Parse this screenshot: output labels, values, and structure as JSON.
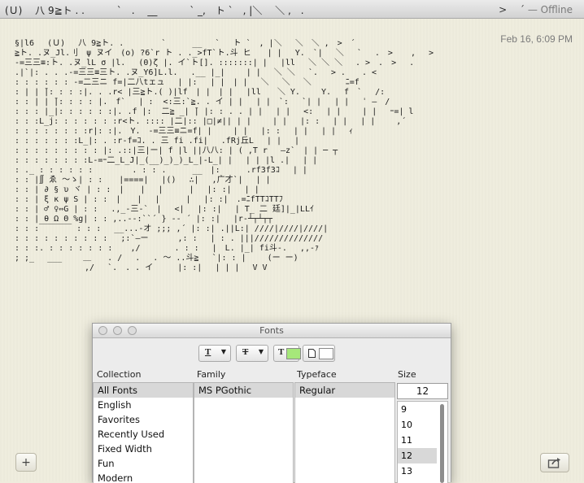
{
  "window": {
    "title_left": "(Ｕ)　 八 9≧ト . .　　　 `　.　 __　　　 ` _,　ト `　, |＼　 ＼ ,　.",
    "title_right_glyphs": ">　 ´",
    "status": "— Offline"
  },
  "note": {
    "timestamp": "Feb 16, 6:09 PM",
    "ascii_art": "§|l6　 (Ｕ)　 八 9≧ト. .　　　　 ` 　　 __　 `　 ト `　, |＼　 ＼　＼ ,　>　´\n≧ト. .ヌ_Jl.刂　ψ ヌイ　(o) ?6`r ト . ._>fT`ト.斗 ヒ　　| |　 Y.　`|　 ＼　 `　 .　> 　 ,　 >\n-=三三≡:ト. .ヌ_lL σ |l.　 (0)ζ |. イ`ト[]. :::::::| |　 |ll　 ＼ ＼ ＼　 . >　.　>　 .\n.|`|: . . .-=三三≡三ト. .ヌ_Y6]L.l.　 .__ |_|　　 | |　 ＼ ＼ 　`. 　> .　　. <\n: : : : : : -=二三ニ f=|二八tェュ　 | |:　 | |　| |　 ＼　 ＼　 ＼　 　 　ﾆ=f\n: | | ̄|: : : :|. . .r< |三≧ト.( )|lf　| |　| |　 |ll　　＼ Y.　　 Y.　 f　`　 /:\n: : | | ̄|: : : : |.　f`　 | :  <:三:`≧. . イ | |　 | |　`:　 `| |　 | |　 ˈ ―　/\n: : : |_|: : : : : :|. .f |:  二≧ _| ̄| |: : . . | |　 | |　 <:　 | |　　 | |　 ｰ=| l\n: : :L_j: : : : : : :r<ト. :::: |二|:: |□|≠|| | |　　 | |　 |: :　 | |　 | |　　 ,´\n: : : : : : : :r|: :|.　Y.　-=三三≡ニ=f| |　　 | |　 |: :　 | |　 | |　 ｨ\n: : : : : : :L_|: . :r-f=ｺ. . 三 fi .fi|　 .fRj丘L　 | |　 |\n: : : : : : : : : |: .::|三|ー| f |l ||八八: | ( ,T r　 ―z`　| | ─ ┬\n: : : : : : : :L-=ｰ二_L_J|_(__)_)_)_L_|-L_| |　 | | |l .|　 | |\n: ._ : : : : : :　 　 　 . : : .　 　 __　|: 　　 .rf3f3ｺ　 | |\n: : |∬ ゑ 〜ゝ| : :　　|====|　 |()　 ∴|　 ,广才`|　 | |\n: : | ∂ § υ ヾ | : :　|　　|　 |　 　 |　 |: :|　 | |\n: : | ξ κ ψ S | : :　|　　|　 |　 　 |　 |: :|　.=ﾆfTTｺTTﾌ\n: : | ♂ ♀⇔G | : :　 .,_-三-`　|　 <| 　|: :|　 | T_ 二 廷]|_|LLｲ\n: : | θ Ω Θ %g| : : ,..-‐:``´ } -‐ ´ |: :|　 |r-┴┬┴┬┬\n: : :￣￣￣￣ : : :　 __...-オ ;;; ,´ |: :| .||L:| ////|////|////|\n: : : : : : : : : :　 ;:`—ー　　　 ,: :　 | : . |||//////////////\n: : :. : : : : : : : 　 ,/　　 　 . : :　 |　L. |_| fi斗-.　 ,,-ｧ\n; ;_ 　___　　 ＿　　. / 　. 　. ～ ..斗≧　 `|: : |　　 (ー ー)\n　　　　　　　　 ,/　 `.　. . イ　　　|: :|　 | | |　 V V"
  },
  "buttons": {
    "add_label": "+",
    "share_icon": "share-icon"
  },
  "fonts_panel": {
    "title": "Fonts",
    "text_color_swatch": "#a6e87a",
    "doc_color_swatch": "#ffffff",
    "headers": {
      "collection": "Collection",
      "family": "Family",
      "typeface": "Typeface",
      "size": "Size"
    },
    "collections": [
      "All Fonts",
      "English",
      "Favorites",
      "Recently Used",
      "Fixed Width",
      "Fun",
      "Modern"
    ],
    "selected_collection": "All Fonts",
    "families": [
      "MS PGothic"
    ],
    "typefaces": [
      "Regular"
    ],
    "size_value": "12",
    "sizes": [
      "9",
      "10",
      "11",
      "12",
      "13"
    ],
    "selected_size": "12"
  }
}
